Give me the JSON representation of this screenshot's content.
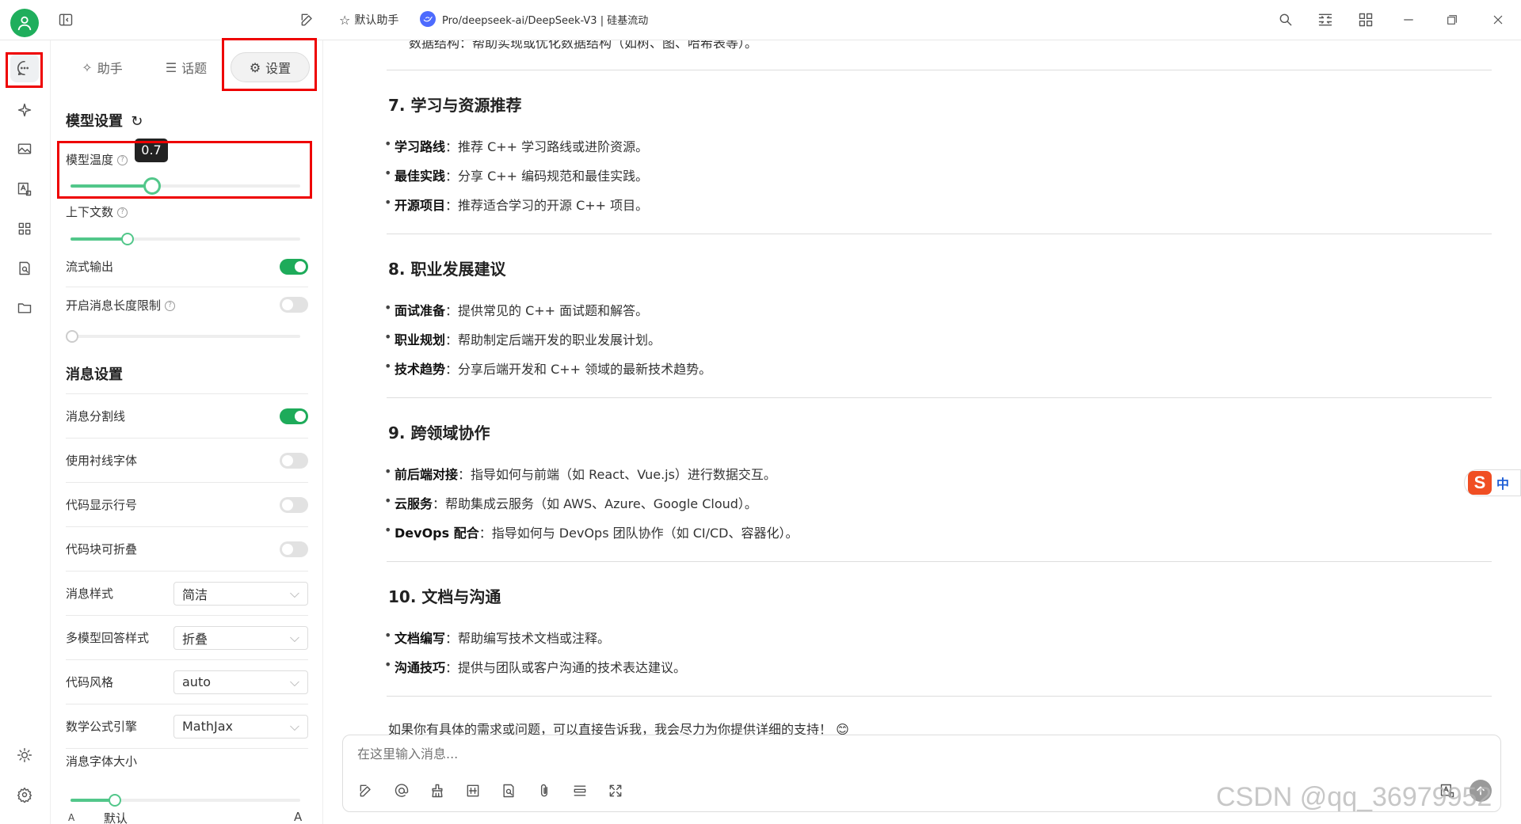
{
  "topbar": {
    "assistant_label": "默认助手",
    "model_label": "Pro/deepseek-ai/DeepSeek-V3 | 硅基流动"
  },
  "panel": {
    "tabs": [
      {
        "label": "助手"
      },
      {
        "label": "话题"
      },
      {
        "label": "设置"
      }
    ],
    "model_settings": {
      "title": "模型设置",
      "temperature_label": "模型温度",
      "temperature_value": "0.7",
      "context_label": "上下文数",
      "context_level": 0.25,
      "stream_label": "流式输出",
      "stream_on": true,
      "maxlen_label": "开启消息长度限制",
      "maxlen_on": false
    },
    "message_settings": {
      "title": "消息设置",
      "rows": [
        {
          "label": "消息分割线",
          "on": true
        },
        {
          "label": "使用衬线字体",
          "on": false
        },
        {
          "label": "代码显示行号",
          "on": false
        },
        {
          "label": "代码块可折叠",
          "on": false
        }
      ],
      "selects": [
        {
          "label": "消息样式",
          "value": "简洁"
        },
        {
          "label": "多模型回答样式",
          "value": "折叠"
        },
        {
          "label": "代码风格",
          "value": "auto"
        },
        {
          "label": "数学公式引擎",
          "value": "MathJax"
        }
      ],
      "font_size_label": "消息字体大小",
      "font_size_small": "A",
      "font_size_default": "默认",
      "font_size_large": "A"
    }
  },
  "content": {
    "top_cut_text": "数据结构：帮助实现或优化数据结构（如树、图、哈希表等）。",
    "sections": [
      {
        "heading": "7. 学习与资源推荐",
        "items": [
          {
            "bold": "学习路线",
            "text": "：推荐 C++ 学习路线或进阶资源。"
          },
          {
            "bold": "最佳实践",
            "text": "：分享 C++ 编码规范和最佳实践。"
          },
          {
            "bold": "开源项目",
            "text": "：推荐适合学习的开源 C++ 项目。"
          }
        ]
      },
      {
        "heading": "8. 职业发展建议",
        "items": [
          {
            "bold": "面试准备",
            "text": "：提供常见的 C++ 面试题和解答。"
          },
          {
            "bold": "职业规划",
            "text": "：帮助制定后端开发的职业发展计划。"
          },
          {
            "bold": "技术趋势",
            "text": "：分享后端开发和 C++ 领域的最新技术趋势。"
          }
        ]
      },
      {
        "heading": "9. 跨领域协作",
        "items": [
          {
            "bold": "前后端对接",
            "text": "：指导如何与前端（如 React、Vue.js）进行数据交互。"
          },
          {
            "bold": "云服务",
            "text": "：帮助集成云服务（如 AWS、Azure、Google Cloud）。"
          },
          {
            "bold": "DevOps 配合",
            "text": "：指导如何与 DevOps 团队协作（如 CI/CD、容器化）。"
          }
        ]
      },
      {
        "heading": "10. 文档与沟通",
        "items": [
          {
            "bold": "文档编写",
            "text": "：帮助编写技术文档或注释。"
          },
          {
            "bold": "沟通技巧",
            "text": "：提供与团队或客户沟通的技术表达建议。"
          }
        ]
      }
    ],
    "closing": "如果你有具体的需求或问题，可以直接告诉我，我会尽力为你提供详细的支持！ 😊"
  },
  "input": {
    "placeholder": "在这里输入消息..."
  },
  "ime_label": "中",
  "watermark": "CSDN @qq_36979952"
}
